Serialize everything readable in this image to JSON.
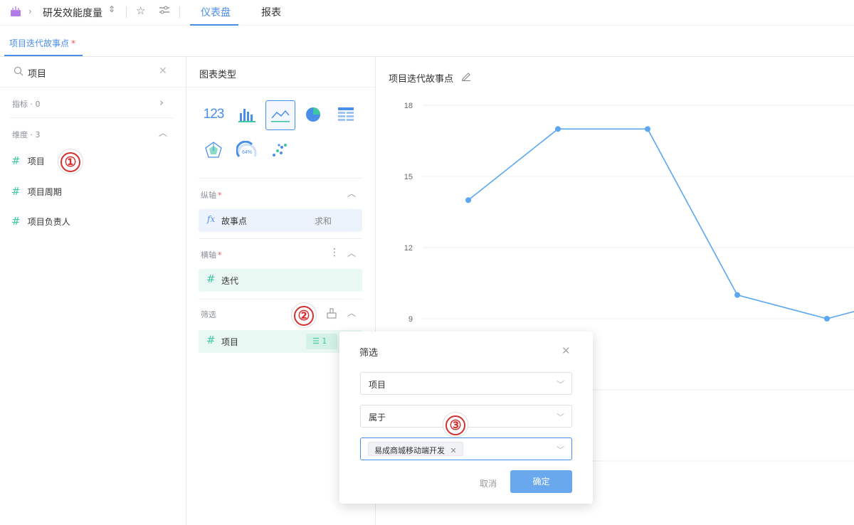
{
  "topbar": {
    "title": "研发效能度量",
    "tabs": [
      "仪表盘",
      "报表"
    ]
  },
  "subtab": {
    "label": "项目迭代故事点",
    "required_mark": "*"
  },
  "left": {
    "search_value": "项目",
    "metrics_label": "指标 · 0",
    "dimensions_label": "维度 · 3",
    "dimensions": [
      "项目",
      "项目周期",
      "项目负责人"
    ]
  },
  "mid": {
    "chart_type_title": "图表类型",
    "kpi_label": "123",
    "gauge_label": "64%",
    "y_axis": {
      "title": "纵轴",
      "required": "*",
      "field": "故事点",
      "agg": "求和",
      "fx": "fx"
    },
    "x_axis": {
      "title": "横轴",
      "required": "*",
      "field": "迭代"
    },
    "filter": {
      "title": "筛选",
      "field": "项目",
      "count": "1"
    }
  },
  "right": {
    "title": "项目迭代故事点"
  },
  "chart_data": {
    "type": "line",
    "title": "项目迭代故事点",
    "ylabel": "故事点",
    "yticks": [
      "18",
      "15",
      "12",
      "9"
    ],
    "ylim": [
      6,
      18
    ],
    "values": [
      14,
      17,
      17,
      10,
      9,
      10
    ],
    "color": "#5ba7f0",
    "grid": true
  },
  "dialog": {
    "title": "筛选",
    "field": "项目",
    "operator": "属于",
    "tag": "易成商城移动端开发",
    "cancel": "取消",
    "confirm": "确定"
  },
  "callouts": [
    "①",
    "②",
    "③"
  ],
  "colors": {
    "accent": "#4a8fe7",
    "green": "#3ec7a3",
    "confirm_bg": "#6aa8ee",
    "line": "#5ba7f0"
  }
}
